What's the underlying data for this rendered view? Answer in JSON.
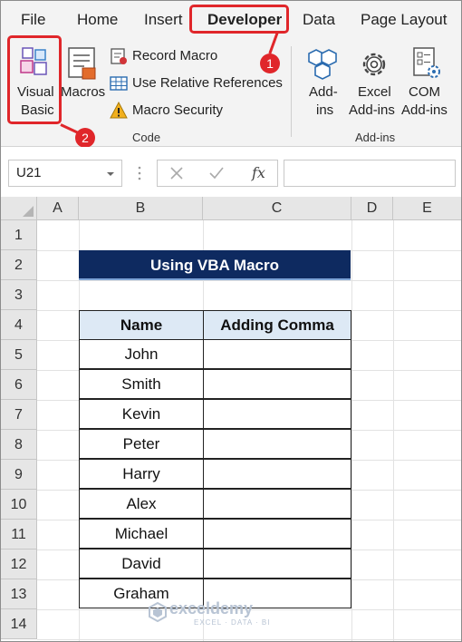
{
  "ribbon_tabs": [
    "File",
    "Home",
    "Insert",
    "Developer",
    "Data",
    "Page Layout"
  ],
  "active_tab": "Developer",
  "code_group": {
    "visual_basic_line1": "Visual",
    "visual_basic_line2": "Basic",
    "macros": "Macros",
    "record_macro": "Record Macro",
    "relative_refs": "Use Relative References",
    "macro_security": "Macro Security",
    "label": "Code"
  },
  "addins_group": {
    "addins_line1": "Add-",
    "addins_line2": "ins",
    "excel_line1": "Excel",
    "excel_line2": "Add-ins",
    "com_line1": "COM",
    "com_line2": "Add-ins",
    "label": "Add-ins"
  },
  "badges": {
    "developer_step": "1",
    "visual_basic_step": "2"
  },
  "formula_bar": {
    "name_box": "U21",
    "fx": "fx",
    "formula": ""
  },
  "columns": [
    "A",
    "B",
    "C",
    "D",
    "E"
  ],
  "rows": [
    "1",
    "2",
    "3",
    "4",
    "5",
    "6",
    "7",
    "8",
    "9",
    "10",
    "11",
    "12",
    "13",
    "14"
  ],
  "sheet": {
    "title": "Using VBA Macro",
    "headers": [
      "Name",
      "Adding Comma"
    ],
    "names": [
      "John",
      "Smith",
      "Kevin",
      "Peter",
      "Harry",
      "Alex",
      "Michael",
      "David",
      "Graham"
    ],
    "comma_values": [
      "",
      "",
      "",
      "",
      "",
      "",
      "",
      "",
      ""
    ]
  },
  "watermark": {
    "brand": "exceldemy",
    "tagline": "EXCEL · DATA · BI"
  },
  "colors": {
    "accent_red": "#e0262a",
    "title_fill": "#0e2a60",
    "header_fill": "#dde9f5"
  }
}
